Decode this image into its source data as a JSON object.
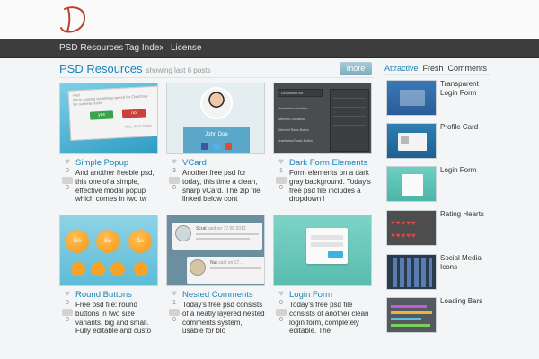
{
  "nav": {
    "items": [
      "PSD Resources",
      "Tag Index",
      "License"
    ]
  },
  "section": {
    "title": "PSD Resources",
    "subtitle": "showing last 6 posts",
    "more_label": "more"
  },
  "sidebar": {
    "tabs": [
      "Attractive",
      "Fresh",
      "Comments"
    ],
    "active_tab": "Attractive",
    "items": [
      {
        "label": "Transparent Login Form"
      },
      {
        "label": "Profile Card"
      },
      {
        "label": "Login Form"
      },
      {
        "label": "Rating Hearts"
      },
      {
        "label": "Social Media Icons"
      },
      {
        "label": "Loading Bars"
      }
    ]
  },
  "posts": [
    {
      "title": "Simple Popup",
      "likes": "0",
      "comments": "0",
      "desc": "And another freebie psd, this one of a simple, effective modal popup which comes in two tw"
    },
    {
      "title": "VCard",
      "likes": "3",
      "comments": "0",
      "desc": "Another free psd for today, this time a clean, sharp vCard. The zip file linked below cont",
      "thumb_name": "John Doe"
    },
    {
      "title": "Dark Form Elements",
      "likes": "1",
      "comments": "0",
      "desc": "Form elements on a dark gray background. Today's free psd file includes a dropdown l"
    },
    {
      "title": "Round Buttons",
      "likes": "0",
      "comments": "0",
      "desc": "Free psd file: round buttons in two size variants, big and small. Fully editable and custo",
      "thumb_button_label": "Go"
    },
    {
      "title": "Nested Comments",
      "likes": "1",
      "comments": "0",
      "desc": "Today's free psd consists of a neatly layered nested comments system, usable for blo",
      "thumb_author1": "Scrat",
      "thumb_said1": "said on 17.08.2012",
      "thumb_author2": "Nut",
      "thumb_said2": "said on 17..."
    },
    {
      "title": "Login Form",
      "likes": "0",
      "comments": "0",
      "desc": "Today's free psd file consists of another clean login form, completely editable. The"
    }
  ],
  "popup_thumb": {
    "line1": "Hey!",
    "line2": "We're cooking something special for Christmas.",
    "line3": "Be our beta tester",
    "yes": "yes",
    "no": "no",
    "footer": "Also, don't follow"
  },
  "dark_thumb": {
    "dropdown": "Dropdown list",
    "rows": [
      "Unselected checkbox",
      "Selected Checkbox",
      "Selected Radio Button",
      "Unselected Radio Button"
    ]
  },
  "colors": {
    "accent": "#1c84b8",
    "nav_bg": "#3d3d3d",
    "background": "#f3f5f6"
  }
}
